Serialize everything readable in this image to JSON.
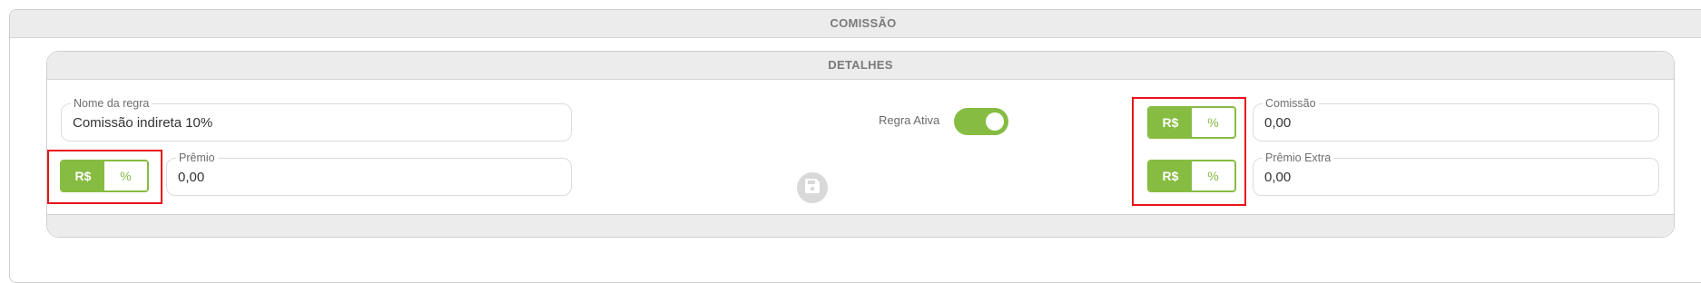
{
  "section": {
    "title": "COMISSÃO"
  },
  "details": {
    "title": "DETALHES"
  },
  "rule_name": {
    "label": "Nome da regra",
    "value": "Comissão indireta 10%"
  },
  "active_toggle": {
    "label": "Regra Ativa",
    "state": "on"
  },
  "unit_toggle": {
    "option_currency": "R$",
    "option_percent": "%",
    "selected": "R$"
  },
  "premio": {
    "label": "Prêmio",
    "value": "0,00"
  },
  "comissao": {
    "label": "Comissão",
    "value": "0,00"
  },
  "premio_extra": {
    "label": "Prêmio Extra",
    "value": "0,00"
  },
  "colors": {
    "accent": "#86bc42",
    "highlight": "#e8141c",
    "header_bg": "#ececec"
  },
  "icons": {
    "save": "save-icon"
  }
}
